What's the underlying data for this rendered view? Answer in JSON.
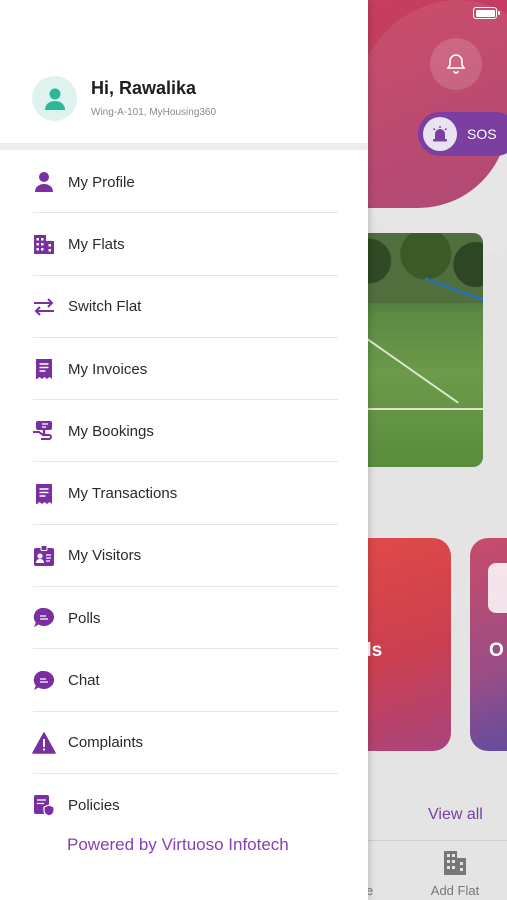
{
  "colors": {
    "brand_purple": "#7a2fa0",
    "header_gradient": [
      "#d84a63",
      "#a83a6a"
    ],
    "drawer_bg": "#ffffff",
    "avatar_bg": "#dff3ee",
    "avatar_fg": "#2bb89a"
  },
  "profile": {
    "greeting": "Hi, Rawalika",
    "subtitle": "Wing-A-101, MyHousing360",
    "avatar_icon": "user-icon"
  },
  "menu": {
    "items": [
      {
        "label": "My Profile",
        "icon": "person-icon"
      },
      {
        "label": "My Flats",
        "icon": "building-icon"
      },
      {
        "label": "Switch Flat",
        "icon": "switch-arrows-icon"
      },
      {
        "label": "My Invoices",
        "icon": "invoice-icon"
      },
      {
        "label": "My Bookings",
        "icon": "booking-hand-icon"
      },
      {
        "label": "My Transactions",
        "icon": "receipt-icon"
      },
      {
        "label": "My Visitors",
        "icon": "visitor-badge-icon"
      },
      {
        "label": "Polls",
        "icon": "chat-bubble-icon"
      },
      {
        "label": "Chat",
        "icon": "chat-bubble-icon"
      },
      {
        "label": "Complaints",
        "icon": "warning-icon"
      },
      {
        "label": "Policies",
        "icon": "policy-shield-icon"
      }
    ]
  },
  "footer": {
    "powered_by": "Powered by Virtuoso Infotech"
  },
  "background": {
    "sos_label": "SOS",
    "card1_partial_text": "ds",
    "card2_partial_text": "O",
    "view_all": "View all",
    "tab_partial_label": "e",
    "tab_add_label": "Add Flat"
  }
}
